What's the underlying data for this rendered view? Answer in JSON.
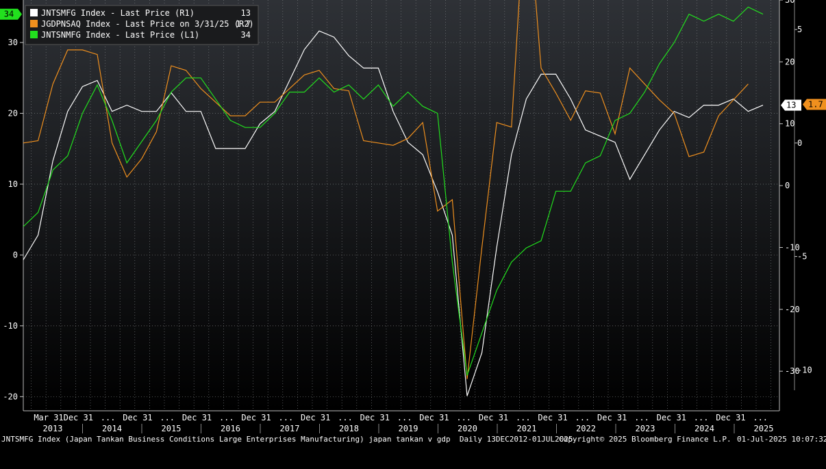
{
  "chart_data": {
    "type": "line",
    "legend": {
      "placement": "top-left",
      "entries": [
        {
          "label": "JNTSMFG Index - Last Price (R1)",
          "value": "13",
          "color": "#ffffff"
        },
        {
          "label": "JGDPNSAQ Index - Last Price on 3/31/25 (R2)",
          "value": "1.7",
          "color": "#f0901e"
        },
        {
          "label": "JNTSNMFG Index - Last Price (L1)",
          "value": "34",
          "color": "#22e01e"
        }
      ]
    },
    "left_axis": {
      "ylim": [
        -22,
        36
      ],
      "ticks": [
        -20,
        -10,
        0,
        10,
        20,
        30
      ]
    },
    "right1_axis": {
      "ylim": [
        -36.4,
        30
      ],
      "ticks": [
        -30,
        -20,
        -10,
        0,
        10,
        20,
        30
      ]
    },
    "right2_axis": {
      "ylim": [
        -11.8,
        6.3
      ],
      "ticks": [
        -10,
        -5,
        0,
        5
      ]
    },
    "x_labels": [
      "Mar 31",
      "Dec 31",
      "...",
      "Dec 31",
      "...",
      "Dec 31",
      "...",
      "Dec 31",
      "...",
      "Dec 31",
      "...",
      "Dec 31",
      "...",
      "Dec 31",
      "...",
      "Dec 31",
      "...",
      "Dec 31",
      "...",
      "Dec 31",
      "...",
      "Dec 31",
      "...",
      "Dec 31",
      "..."
    ],
    "years": [
      "2013",
      "2014",
      "2015",
      "2016",
      "2017",
      "2018",
      "2019",
      "2020",
      "2021",
      "2022",
      "2023",
      "2024",
      "2025"
    ],
    "x_start": 2013.0,
    "series": [
      {
        "name": "JNTSMFG Index - Last Price (R1)",
        "axis": "right1",
        "color": "#ffffff",
        "values": [
          -12,
          -8,
          4,
          12,
          16,
          17,
          12,
          13,
          12,
          12,
          15,
          12,
          12,
          6,
          6,
          6,
          10,
          12,
          17,
          22,
          25,
          24,
          21,
          19,
          19,
          12,
          7,
          5,
          -1,
          -8,
          -34,
          -27,
          -10,
          5,
          14,
          18,
          18,
          14,
          9,
          8,
          7,
          1,
          5,
          9,
          12,
          11,
          13,
          13,
          14,
          12,
          13
        ]
      },
      {
        "name": "JGDPNSAQ Index - Last Price on 3/31/25 (R2)",
        "axis": "right2",
        "color": "#f0901e",
        "values": [
          0,
          0.1,
          2.6,
          4.1,
          4.1,
          3.9,
          0,
          -1.5,
          -0.7,
          0.5,
          3.4,
          3.2,
          2.4,
          1.8,
          1.2,
          1.2,
          1.8,
          1.8,
          2.4,
          3.0,
          3.2,
          2.4,
          2.3,
          0.1,
          0,
          -0.1,
          0.2,
          0.9,
          -3.0,
          -2.5,
          -10.4,
          -4.6,
          0.9,
          0.7,
          11.5,
          3.3,
          2.2,
          1.0,
          2.3,
          2.2,
          0.4,
          3.3,
          2.6,
          1.9,
          1.3,
          -0.6,
          -0.4,
          1.2,
          1.9,
          2.6
        ]
      },
      {
        "name": "JNTSNMFG Index - Last Price (L1)",
        "axis": "left",
        "color": "#22e01e",
        "values": [
          4,
          6,
          12,
          14,
          20,
          24,
          19,
          13,
          16,
          19,
          23,
          25,
          25,
          22,
          19,
          18,
          18,
          20,
          23,
          23,
          25,
          23,
          24,
          22,
          24,
          21,
          23,
          21,
          20,
          -1,
          -17,
          -11,
          -5,
          -1,
          1,
          2,
          9,
          9,
          13,
          14,
          19,
          20,
          23,
          27,
          30,
          34,
          33,
          34,
          33,
          35,
          34
        ]
      }
    ],
    "flags": [
      {
        "side": "left",
        "value": "34",
        "color": "#22e01e"
      },
      {
        "side": "right",
        "value": "13",
        "color": "#ffffff"
      },
      {
        "side": "right",
        "value": "1.7",
        "color": "#f0901e"
      }
    ]
  },
  "footer": {
    "description": "JNTSMFG Index (Japan Tankan Business Conditions Large Enterprises Manufacturing) japan tankan v gdp  Daily 13DEC2012-01JUL2025",
    "copyright": "Copyright© 2025 Bloomberg Finance L.P.",
    "timestamp": "01-Jul-2025 10:07:32"
  }
}
